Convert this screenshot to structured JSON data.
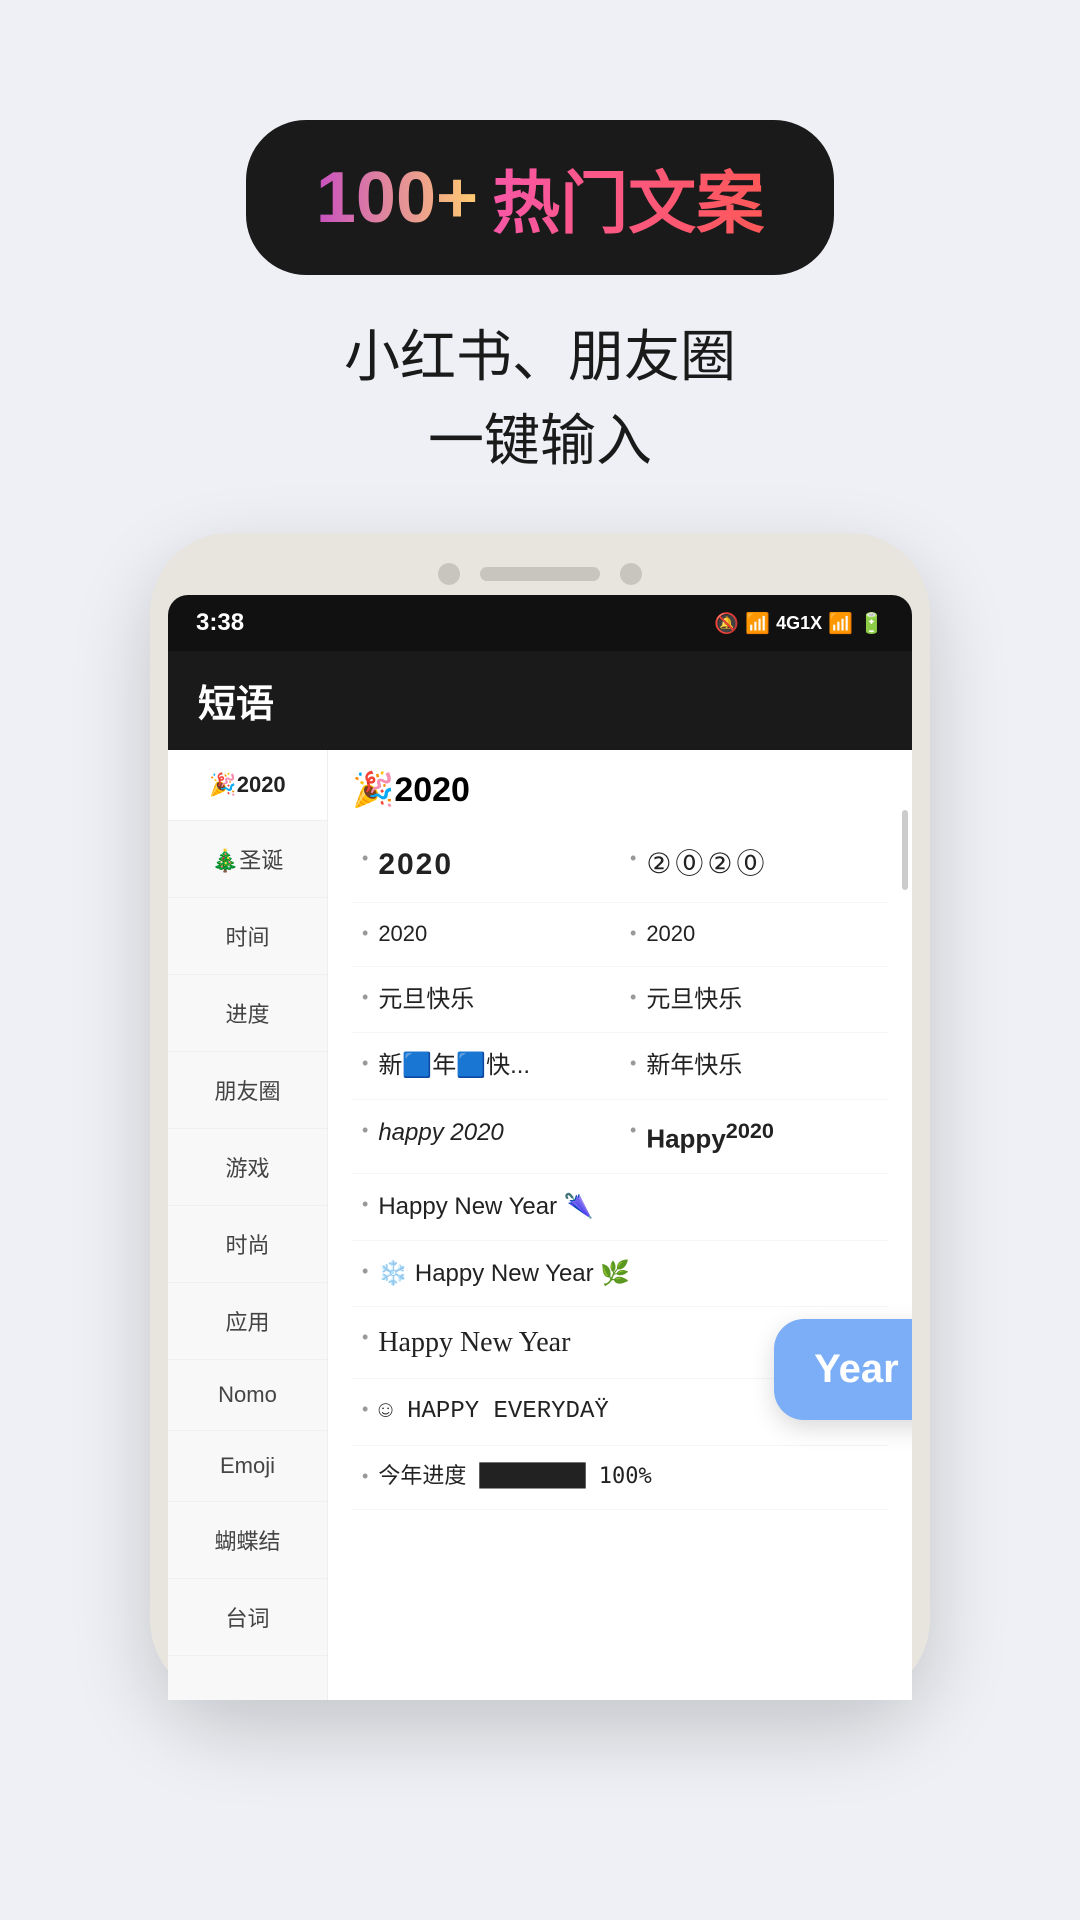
{
  "page": {
    "bg_color": "#eef0f5"
  },
  "header": {
    "badge": {
      "number": "100+",
      "text": "热门文案"
    },
    "subtitle_line1": "小红书、朋友圈",
    "subtitle_line2": "一键输入"
  },
  "phone": {
    "status_bar": {
      "time": "3:38",
      "icons": "🔕 📶 4G 📶 🔋"
    },
    "app_title": "短语",
    "sidebar_items": [
      {
        "label": "🎉2020",
        "active": true
      },
      {
        "label": "🎄圣诞",
        "active": false
      },
      {
        "label": "时间",
        "active": false
      },
      {
        "label": "进度",
        "active": false
      },
      {
        "label": "朋友圈",
        "active": false
      },
      {
        "label": "游戏",
        "active": false
      },
      {
        "label": "时尚",
        "active": false
      },
      {
        "label": "应用",
        "active": false
      },
      {
        "label": "Nomo",
        "active": false
      },
      {
        "label": "Emoji",
        "active": false
      },
      {
        "label": "蝴蝶结",
        "active": false
      },
      {
        "label": "台词",
        "active": false
      }
    ],
    "category_title": "🎉2020",
    "items": [
      {
        "text": "2020",
        "style": "styled-2020",
        "col": 1
      },
      {
        "text": "②⓪②⓪",
        "style": "circled",
        "col": 2
      },
      {
        "text": "2020",
        "style": "small-2020",
        "col": 1
      },
      {
        "text": "2020",
        "style": "small-2020",
        "col": 2
      },
      {
        "text": "元旦快乐",
        "style": "normal",
        "col": 1
      },
      {
        "text": "元旦快乐",
        "style": "normal",
        "col": 2
      },
      {
        "text": "新🟦年🟦快...",
        "style": "normal",
        "col": 1
      },
      {
        "text": "新年快乐...",
        "style": "normal",
        "col": 2
      },
      {
        "text": "happy 2020",
        "style": "italic-happy",
        "col": 1
      },
      {
        "text": "Happy²⁰²⁰",
        "style": "bold-happy",
        "col": 2
      },
      {
        "text": "Happy New Year 🌂",
        "style": "normal",
        "col": "full"
      },
      {
        "text": "❄️ Happy New Year 🌿",
        "style": "normal",
        "col": "full"
      },
      {
        "text": "Happy New Year",
        "style": "script",
        "col": "full"
      },
      {
        "text": "☺ HAPPY EVERYDAŸ",
        "style": "decorative",
        "col": "full"
      },
      {
        "text": "今年进度 ████████ 100%",
        "style": "progress-bar",
        "col": "full"
      }
    ],
    "bubble_text": "Year Pr"
  }
}
